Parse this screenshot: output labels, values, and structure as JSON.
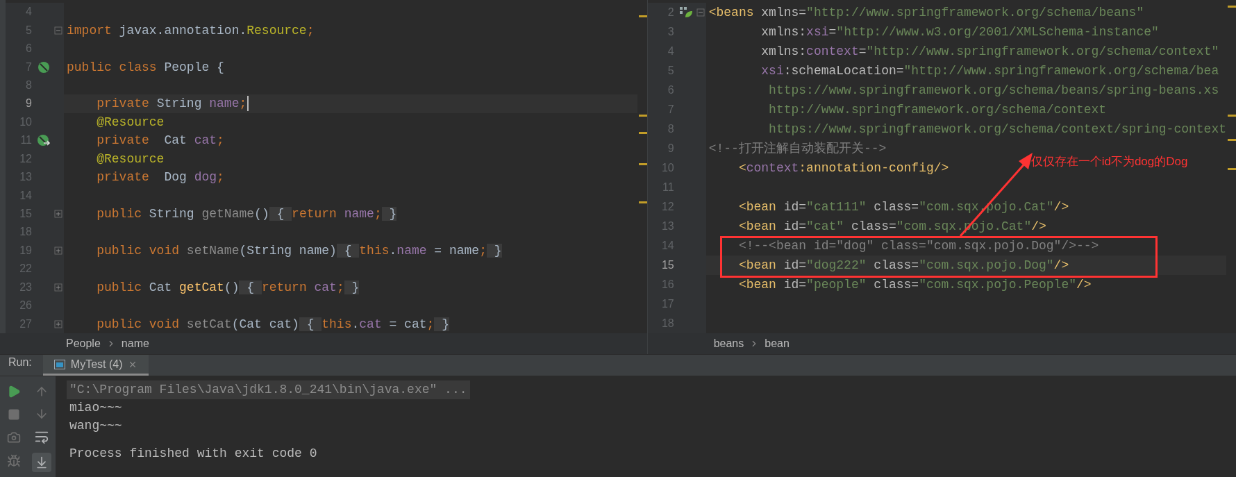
{
  "left_editor": {
    "lines": [
      {
        "number": "4",
        "current": false
      },
      {
        "number": "5",
        "current": false,
        "gutter": {
          "kind": "fold-minus"
        },
        "tokens": [
          {
            "text": "import",
            "kind": "keyword"
          },
          {
            "text": " javax.annotation.",
            "kind": "plain"
          },
          {
            "text": "Resource",
            "kind": "annotation"
          },
          {
            "text": ";",
            "kind": "keyword"
          }
        ]
      },
      {
        "number": "6",
        "current": false
      },
      {
        "number": "7",
        "current": false,
        "gutter": {
          "kind": "bean"
        },
        "tokens": [
          {
            "text": "public class ",
            "kind": "keyword"
          },
          {
            "text": "People {",
            "kind": "plain"
          }
        ]
      },
      {
        "number": "8",
        "current": false
      },
      {
        "number": "9",
        "current": true,
        "caret": true,
        "tokens": [
          {
            "text": "    private ",
            "kind": "keyword"
          },
          {
            "text": "String ",
            "kind": "plain"
          },
          {
            "text": "name",
            "kind": "field"
          },
          {
            "text": ";",
            "kind": "keyword"
          }
        ]
      },
      {
        "number": "10",
        "current": false,
        "tokens": [
          {
            "text": "    @Resource",
            "kind": "annotation"
          }
        ]
      },
      {
        "number": "11",
        "current": false,
        "gutter": {
          "kind": "bean-inject"
        },
        "tokens": [
          {
            "text": "    private ",
            "kind": "keyword"
          },
          {
            "text": " Cat ",
            "kind": "plain"
          },
          {
            "text": "cat",
            "kind": "field"
          },
          {
            "text": ";",
            "kind": "keyword"
          }
        ]
      },
      {
        "number": "12",
        "current": false,
        "tokens": [
          {
            "text": "    @Resource",
            "kind": "annotation"
          }
        ]
      },
      {
        "number": "13",
        "current": false,
        "tokens": [
          {
            "text": "    private ",
            "kind": "keyword"
          },
          {
            "text": " Dog ",
            "kind": "plain"
          },
          {
            "text": "dog",
            "kind": "field"
          },
          {
            "text": ";",
            "kind": "keyword"
          }
        ]
      },
      {
        "number": "14",
        "current": false
      },
      {
        "number": "15",
        "current": false,
        "gutter": {
          "kind": "fold-plus"
        },
        "tokens": [
          {
            "text": "    public ",
            "kind": "keyword"
          },
          {
            "text": "String ",
            "kind": "plain"
          },
          {
            "text": "getName",
            "kind": "unused"
          },
          {
            "text": "()",
            "kind": "plain"
          },
          {
            "text": " { ",
            "kind": "fold"
          },
          {
            "text": "return ",
            "kind": "keyword"
          },
          {
            "text": "name",
            "kind": "field"
          },
          {
            "text": ";",
            "kind": "keyword"
          },
          {
            "text": " }",
            "kind": "fold"
          }
        ]
      },
      {
        "number": "18",
        "current": false
      },
      {
        "number": "19",
        "current": false,
        "gutter": {
          "kind": "fold-plus"
        },
        "tokens": [
          {
            "text": "    public void ",
            "kind": "keyword"
          },
          {
            "text": "setName",
            "kind": "unused"
          },
          {
            "text": "(String name)",
            "kind": "plain"
          },
          {
            "text": " { ",
            "kind": "fold"
          },
          {
            "text": "this",
            "kind": "keyword"
          },
          {
            "text": ".",
            "kind": "plain"
          },
          {
            "text": "name",
            "kind": "field"
          },
          {
            "text": " = name",
            "kind": "plain"
          },
          {
            "text": ";",
            "kind": "keyword"
          },
          {
            "text": " }",
            "kind": "fold"
          }
        ]
      },
      {
        "number": "22",
        "current": false
      },
      {
        "number": "23",
        "current": false,
        "gutter": {
          "kind": "fold-plus"
        },
        "tokens": [
          {
            "text": "    public ",
            "kind": "keyword"
          },
          {
            "text": "Cat ",
            "kind": "plain"
          },
          {
            "text": "getCat",
            "kind": "method"
          },
          {
            "text": "()",
            "kind": "plain"
          },
          {
            "text": " { ",
            "kind": "fold"
          },
          {
            "text": "return ",
            "kind": "keyword"
          },
          {
            "text": "cat",
            "kind": "field"
          },
          {
            "text": ";",
            "kind": "keyword"
          },
          {
            "text": " }",
            "kind": "fold"
          }
        ]
      },
      {
        "number": "26",
        "current": false
      },
      {
        "number": "27",
        "current": false,
        "gutter": {
          "kind": "fold-plus"
        },
        "tokens": [
          {
            "text": "    public void ",
            "kind": "keyword"
          },
          {
            "text": "setCat",
            "kind": "unused"
          },
          {
            "text": "(Cat cat)",
            "kind": "plain"
          },
          {
            "text": " { ",
            "kind": "fold"
          },
          {
            "text": "this",
            "kind": "keyword"
          },
          {
            "text": ".",
            "kind": "plain"
          },
          {
            "text": "cat",
            "kind": "field"
          },
          {
            "text": " = cat",
            "kind": "plain"
          },
          {
            "text": ";",
            "kind": "keyword"
          },
          {
            "text": " }",
            "kind": "fold"
          }
        ]
      }
    ],
    "breadcrumbs": [
      "People",
      "name"
    ]
  },
  "right_editor": {
    "lines": [
      {
        "number": "2",
        "current": false,
        "gutter": {
          "kind": "spring"
        },
        "fold": true,
        "tokens": [
          {
            "text": "<beans",
            "kind": "tag"
          },
          {
            "text": " xmlns",
            "kind": "attr"
          },
          {
            "text": "=",
            "kind": "attr"
          },
          {
            "text": "\"http://www.springframework.org/schema/beans\"",
            "kind": "string"
          }
        ]
      },
      {
        "number": "3",
        "current": false,
        "tokens": [
          {
            "text": "       xmlns:",
            "kind": "attr"
          },
          {
            "text": "xsi",
            "kind": "ns"
          },
          {
            "text": "=",
            "kind": "attr"
          },
          {
            "text": "\"http://www.w3.org/2001/XMLSchema-instance\"",
            "kind": "string"
          }
        ]
      },
      {
        "number": "4",
        "current": false,
        "tokens": [
          {
            "text": "       xmlns:",
            "kind": "attr"
          },
          {
            "text": "context",
            "kind": "ns"
          },
          {
            "text": "=",
            "kind": "attr"
          },
          {
            "text": "\"http://www.springframework.org/schema/context\"",
            "kind": "string"
          }
        ]
      },
      {
        "number": "5",
        "current": false,
        "tokens": [
          {
            "text": "       xsi",
            "kind": "ns"
          },
          {
            "text": ":schemaLocation",
            "kind": "attr"
          },
          {
            "text": "=",
            "kind": "attr"
          },
          {
            "text": "\"http://www.springframework.org/schema/bea",
            "kind": "string"
          }
        ]
      },
      {
        "number": "6",
        "current": false,
        "tokens": [
          {
            "text": "        https://www.springframework.org/schema/beans/spring-beans.xs",
            "kind": "string"
          }
        ]
      },
      {
        "number": "7",
        "current": false,
        "tokens": [
          {
            "text": "        http://www.springframework.org/schema/context",
            "kind": "string"
          }
        ]
      },
      {
        "number": "8",
        "current": false,
        "tokens": [
          {
            "text": "        https://www.springframework.org/schema/context/spring-context",
            "kind": "string"
          }
        ]
      },
      {
        "number": "9",
        "current": false,
        "tokens": [
          {
            "text": "<!--打开注解自动装配开关-->",
            "kind": "comment"
          }
        ]
      },
      {
        "number": "10",
        "current": false,
        "tokens": [
          {
            "text": "    <",
            "kind": "tag"
          },
          {
            "text": "context",
            "kind": "ns"
          },
          {
            "text": ":annotation-config/>",
            "kind": "tag"
          }
        ]
      },
      {
        "number": "11",
        "current": false
      },
      {
        "number": "12",
        "current": false,
        "tokens": [
          {
            "text": "    <bean",
            "kind": "tag"
          },
          {
            "text": " id",
            "kind": "attr"
          },
          {
            "text": "=",
            "kind": "attr"
          },
          {
            "text": "\"cat111\"",
            "kind": "string"
          },
          {
            "text": " class",
            "kind": "attr"
          },
          {
            "text": "=",
            "kind": "attr"
          },
          {
            "text": "\"com.sqx.pojo.Cat\"",
            "kind": "string"
          },
          {
            "text": "/>",
            "kind": "tag"
          }
        ]
      },
      {
        "number": "13",
        "current": false,
        "tokens": [
          {
            "text": "    <bean",
            "kind": "tag"
          },
          {
            "text": " id",
            "kind": "attr"
          },
          {
            "text": "=",
            "kind": "attr"
          },
          {
            "text": "\"cat\"",
            "kind": "string"
          },
          {
            "text": " class",
            "kind": "attr"
          },
          {
            "text": "=",
            "kind": "attr"
          },
          {
            "text": "\"com.sqx.pojo.Cat\"",
            "kind": "string"
          },
          {
            "text": "/>",
            "kind": "tag"
          }
        ]
      },
      {
        "number": "14",
        "current": false,
        "tokens": [
          {
            "text": "    <!--<bean id=\"dog\" class=\"com.sqx.pojo.Dog\"/>-->",
            "kind": "comment"
          }
        ]
      },
      {
        "number": "15",
        "current": true,
        "tokens": [
          {
            "text": "    <bean",
            "kind": "tag"
          },
          {
            "text": " id",
            "kind": "attr"
          },
          {
            "text": "=",
            "kind": "attr"
          },
          {
            "text": "\"dog222\"",
            "kind": "string"
          },
          {
            "text": " class",
            "kind": "attr"
          },
          {
            "text": "=",
            "kind": "attr"
          },
          {
            "text": "\"com.sqx.pojo.Dog\"",
            "kind": "string"
          },
          {
            "text": "/>",
            "kind": "tag"
          }
        ]
      },
      {
        "number": "16",
        "current": false,
        "tokens": [
          {
            "text": "    <bean",
            "kind": "tag"
          },
          {
            "text": " id",
            "kind": "attr"
          },
          {
            "text": "=",
            "kind": "attr"
          },
          {
            "text": "\"people\"",
            "kind": "string"
          },
          {
            "text": " class",
            "kind": "attr"
          },
          {
            "text": "=",
            "kind": "attr"
          },
          {
            "text": "\"com.sqx.pojo.People\"",
            "kind": "string"
          },
          {
            "text": "/>",
            "kind": "tag"
          }
        ]
      },
      {
        "number": "17",
        "current": false
      },
      {
        "number": "18",
        "current": false
      }
    ],
    "breadcrumbs": [
      "beans",
      "bean"
    ],
    "note": {
      "text": "仅仅存在一个id不为dog的Dog"
    }
  },
  "run_panel": {
    "label": "Run:",
    "tabs": [
      {
        "label": "MyTest (4)",
        "selected": true
      }
    ],
    "console": [
      {
        "text": "\"C:\\Program Files\\Java\\jdk1.8.0_241\\bin\\java.exe\" ...",
        "kind": "command"
      },
      {
        "text": "miao~~~",
        "kind": "output"
      },
      {
        "text": "wang~~~",
        "kind": "output"
      },
      {
        "kind": "blank"
      },
      {
        "text": "Process finished with exit code 0",
        "kind": "output"
      }
    ]
  }
}
